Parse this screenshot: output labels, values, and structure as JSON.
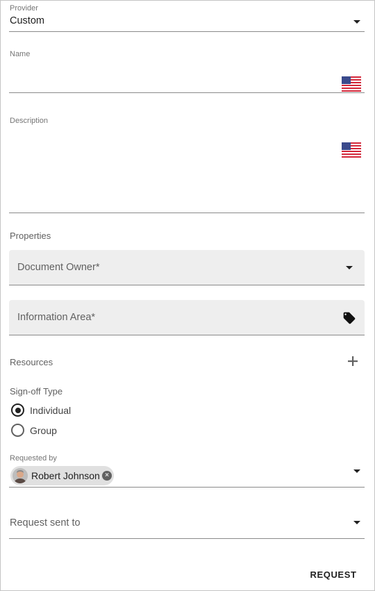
{
  "form": {
    "provider": {
      "label": "Provider",
      "value": "Custom"
    },
    "name": {
      "label": "Name",
      "value": "",
      "flag_icon": "us-flag-icon"
    },
    "description": {
      "label": "Description",
      "value": "",
      "flag_icon": "us-flag-icon"
    },
    "properties": {
      "heading": "Properties",
      "document_owner": {
        "placeholder": "Document Owner*"
      },
      "information_area": {
        "placeholder": "Information Area*",
        "icon": "tag-icon"
      }
    },
    "resources": {
      "label": "Resources",
      "add_icon": "plus-icon"
    },
    "signoff": {
      "label": "Sign-off Type",
      "options": [
        {
          "label": "Individual",
          "selected": true
        },
        {
          "label": "Group",
          "selected": false
        }
      ]
    },
    "requested_by": {
      "label": "Requested by",
      "chip": {
        "name": "Robert Johnson",
        "remove_icon": "close-circle-icon"
      }
    },
    "request_sent_to": {
      "placeholder": "Request sent to"
    },
    "submit": {
      "label": "REQUEST"
    }
  },
  "colors": {
    "field_fill": "#eeeeee",
    "underline": "#8a8a8a",
    "chip": "#e0e0e0",
    "text": "#212121",
    "muted": "#757575"
  }
}
